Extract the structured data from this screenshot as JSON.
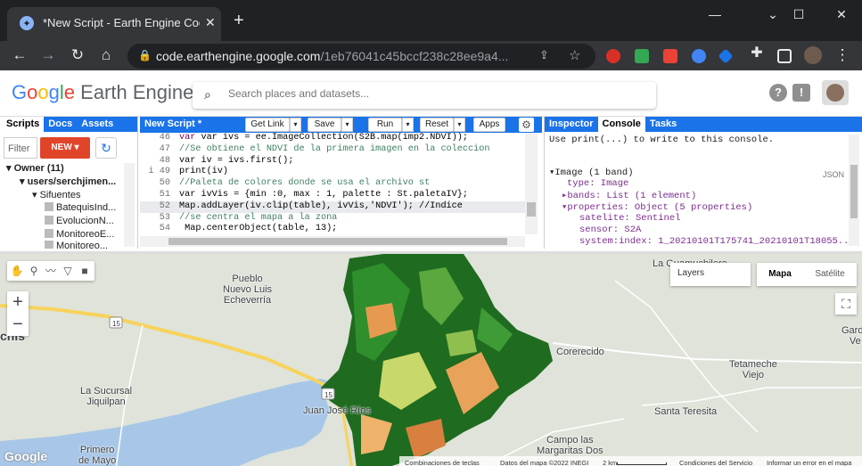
{
  "browser": {
    "tab_title": "*New Script - Earth Engine Code",
    "tab_close": "✕",
    "new_tab": "+",
    "url_domain": "code.earthengine.google.com",
    "url_path": "/1eb76041c45bccf238c28ee9a4...",
    "window_controls": {
      "minimize": "—",
      "maximize": "☐",
      "close": "✕",
      "tab_menu": "⌄"
    }
  },
  "header": {
    "logo_google": [
      "G",
      "o",
      "o",
      "g",
      "l",
      "e"
    ],
    "logo_product": "Earth Engine",
    "search_placeholder": "Search places and datasets..."
  },
  "left_panel": {
    "tabs": [
      "Scripts",
      "Docs",
      "Assets"
    ],
    "filter_placeholder": "Filter",
    "new_label": "NEW ▾",
    "tree": [
      {
        "text": "▾ Owner (11)",
        "bold": true
      },
      {
        "text": "▾ users/serchjimen...",
        "bold": true
      },
      {
        "text": "▾ Sifuentes",
        "bold": false
      },
      {
        "text": "BatequisInd...",
        "bold": false
      },
      {
        "text": "EvolucionN...",
        "bold": false
      },
      {
        "text": "MonitoreoE...",
        "bold": false
      },
      {
        "text": "Monitoreo...",
        "bold": false
      }
    ]
  },
  "editor": {
    "title": "New Script *",
    "buttons": {
      "get_link": "Get Link",
      "save": "Save",
      "run": "Run",
      "reset": "Reset",
      "apps": "Apps"
    },
    "lines": [
      {
        "num": "46",
        "code": "var ivs = ee.ImageCollection(S2B.map(imp2.NDVI));"
      },
      {
        "num": "47",
        "code": "//Se obtiene el NDVI de la primera imagen en la coleccion"
      },
      {
        "num": "48",
        "code": "var iv = ivs.first();"
      },
      {
        "num": "i 49",
        "code": "print(iv)"
      },
      {
        "num": "50",
        "code": "//Paleta de colores donde se usa el archivo st"
      },
      {
        "num": "51",
        "code": "var ivVis = {min :0, max : 1, palette : St.paletaIV};"
      },
      {
        "num": "52",
        "code": "Map.addLayer(iv.clip(table), ivVis,'NDVI'); //Indice"
      },
      {
        "num": "53",
        "code": "//se centra el mapa a la zona"
      },
      {
        "num": "54",
        "code": " Map.centerObject(table, 13);"
      }
    ]
  },
  "right_panel": {
    "tabs": [
      "Inspector",
      "Console",
      "Tasks"
    ],
    "hint": "Use print(...) to write to this console.",
    "json_label": "JSON",
    "entries": [
      {
        "text": "▾Image (1 band)",
        "indent": 0
      },
      {
        "text": "type: Image",
        "indent": 2
      },
      {
        "text": "▸bands: List (1 element)",
        "indent": 1
      },
      {
        "text": "▾properties: Object (5 properties)",
        "indent": 1
      },
      {
        "text": "satelite: Sentinel",
        "indent": 3
      },
      {
        "text": "sensor: S2A",
        "indent": 3
      },
      {
        "text": "system:index: 1_20210101T175741_20210101T18055...",
        "indent": 3
      }
    ]
  },
  "map": {
    "layers_label": "Layers",
    "maptype": [
      "Mapa",
      "Satélite"
    ],
    "places": [
      {
        "name": "Pueblo\nNuevo Luis\nEcheverría"
      },
      {
        "name": "La Sucursal\nJiquilpan"
      },
      {
        "name": "Juan José Ríos"
      },
      {
        "name": "Primero\nde Mayo"
      },
      {
        "name": "Corerecido"
      },
      {
        "name": "Tetameche\nViejo"
      },
      {
        "name": "Santa Teresita"
      },
      {
        "name": "Campo las\nMargaritas Dos"
      },
      {
        "name": "La Guamuchilera"
      },
      {
        "name": "Garde\nVe"
      },
      {
        "name": "chis"
      }
    ],
    "road_shield_1": "15",
    "road_shield_2": "15",
    "google_mark": "Google",
    "attribution": [
      "Combinaciones de teclas",
      "Datos del mapa ©2022 INEGI",
      "2 km",
      "Condiciones del Servicio",
      "Informar un error en el mapa"
    ]
  }
}
